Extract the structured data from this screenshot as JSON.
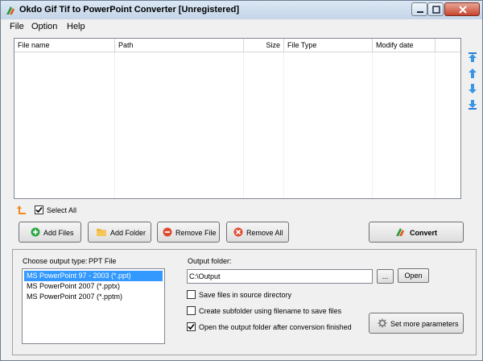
{
  "window": {
    "title": "Okdo Gif Tif to PowerPoint Converter [Unregistered]"
  },
  "menu": {
    "items": [
      "File",
      "Option",
      "Help"
    ]
  },
  "file_list": {
    "columns": [
      "File name",
      "Path",
      "Size",
      "File Type",
      "Modify date"
    ],
    "rows": []
  },
  "select_all": {
    "label": "Select All",
    "checked": true
  },
  "actions": {
    "add_files": "Add Files",
    "add_folder": "Add Folder",
    "remove_file": "Remove File",
    "remove_all": "Remove All",
    "convert": "Convert"
  },
  "output_type": {
    "label": "Choose output type:",
    "current": "PPT File",
    "options": [
      "MS PowerPoint 97 - 2003 (*.ppt)",
      "MS PowerPoint 2007 (*.pptx)",
      "MS PowerPoint 2007 (*.pptm)"
    ],
    "selected_index": 0
  },
  "output_folder": {
    "label": "Output folder:",
    "value": "C:\\Output",
    "browse": "...",
    "open": "Open"
  },
  "options": {
    "save_in_source": {
      "label": "Save files in source directory",
      "checked": false
    },
    "create_subfolder": {
      "label": "Create subfolder using filename to save files",
      "checked": false
    },
    "open_after": {
      "label": "Open the output folder after conversion finished",
      "checked": true
    }
  },
  "set_params": "Set more parameters",
  "colors": {
    "selection": "#3399ff",
    "window_bg": "#f0f0f0",
    "close_btn": "#c7452f"
  }
}
